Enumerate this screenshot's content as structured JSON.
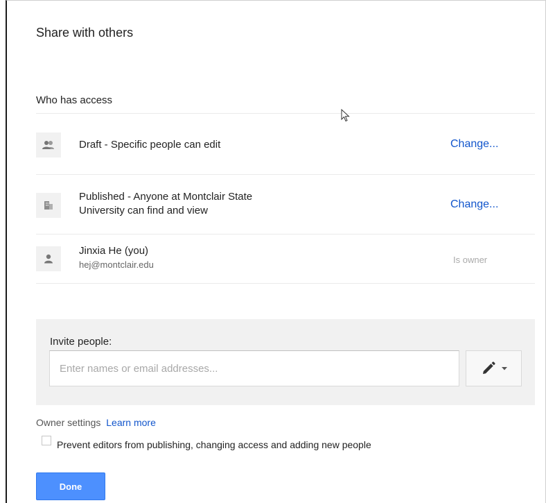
{
  "dialog": {
    "title": "Share with others",
    "access_heading": "Who has access"
  },
  "access_rows": [
    {
      "icon": "people-icon",
      "text": "Draft - Specific people can edit",
      "action": "Change..."
    },
    {
      "icon": "building-icon",
      "text_line1": "Published - Anyone at Montclair State",
      "text_line2": "University can find and view",
      "action": "Change..."
    },
    {
      "icon": "person-icon",
      "name": "Jinxia He (you)",
      "email": "hej@montclair.edu",
      "role": "Is owner"
    }
  ],
  "invite": {
    "label": "Invite people:",
    "placeholder": "Enter names or email addresses...",
    "permission_icon": "pencil-icon"
  },
  "owner_settings": {
    "label": "Owner settings",
    "learn_more": "Learn more",
    "checkbox_label": "Prevent editors from publishing, changing access and adding new people",
    "checked": false
  },
  "footer": {
    "done_label": "Done"
  },
  "colors": {
    "link": "#1155cc",
    "primary_button": "#4d90fe",
    "panel_bg": "#f1f1f1"
  }
}
